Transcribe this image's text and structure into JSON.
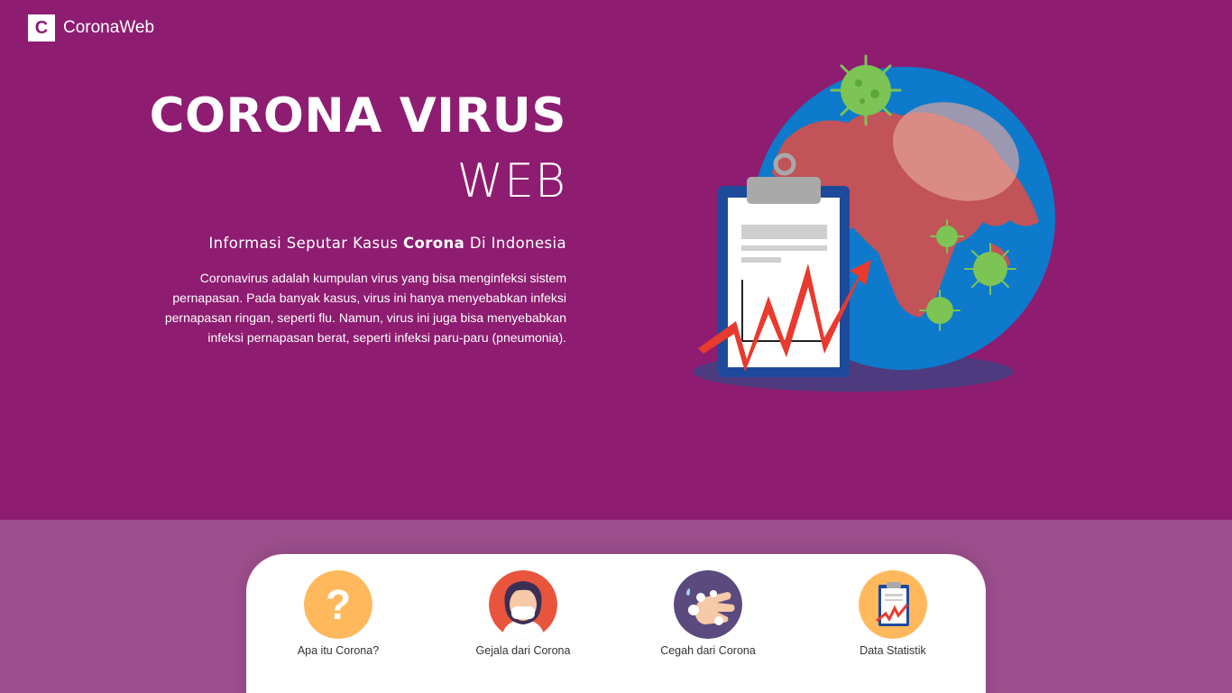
{
  "brand": {
    "logo_letter": "C",
    "name": "CoronaWeb"
  },
  "hero": {
    "title_line1": "CORONA VIRUS",
    "title_line2": "WEB",
    "subtitle_prefix": "Informasi Seputar Kasus ",
    "subtitle_bold": "Corona",
    "subtitle_suffix": " Di Indonesia",
    "description": "Coronavirus adalah kumpulan virus yang bisa menginfeksi sistem pernapasan. Pada banyak kasus, virus ini hanya menyebabkan infeksi pernapasan ringan, seperti flu. Namun, virus ini juga bisa menyebabkan infeksi pernapasan berat, seperti infeksi paru-paru (pneumonia)."
  },
  "menu": [
    {
      "label": "Apa itu Corona?",
      "icon": "question-icon"
    },
    {
      "label": "Gejala dari Corona",
      "icon": "masked-person-icon"
    },
    {
      "label": "Cegah dari Corona",
      "icon": "hand-washing-icon"
    },
    {
      "label": "Data Statistik",
      "icon": "clipboard-chart-icon"
    }
  ],
  "colors": {
    "hero_bg": "#8e1c71",
    "bottom_bg": "#9b4f8c",
    "globe_ocean": "#0d7acb",
    "globe_land": "#c25358",
    "virus_green": "#7cc454",
    "chart_red": "#e83a2e",
    "icon_orange": "#ffb85c",
    "icon_red": "#e8553c",
    "icon_purple": "#5b4a7e"
  }
}
